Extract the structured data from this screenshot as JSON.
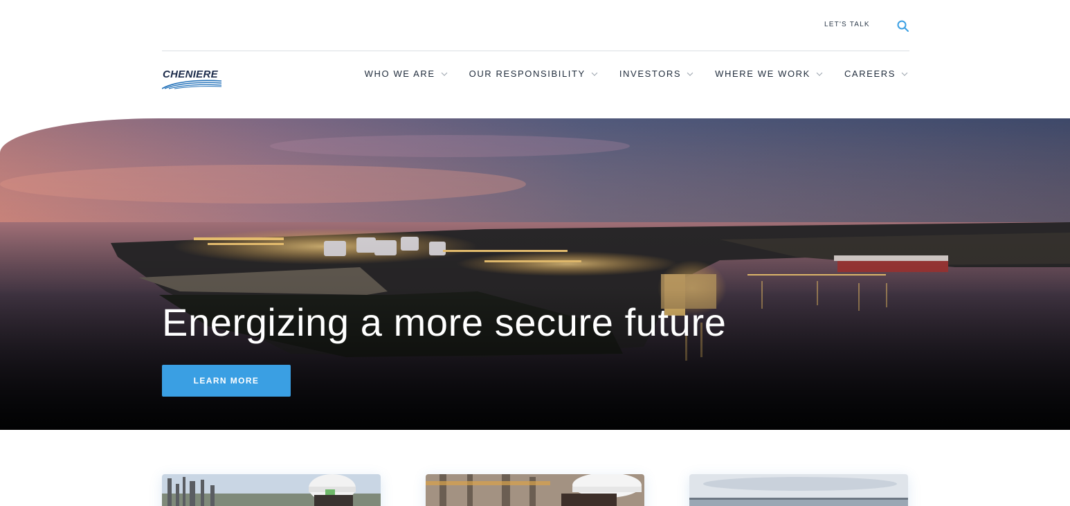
{
  "utility": {
    "lets_talk": "LET'S TALK",
    "search_icon": "search-icon"
  },
  "brand": {
    "logo_text": "CHENIERE",
    "color_primary": "#1c2b4a",
    "color_swoosh": "#1f6fb8"
  },
  "nav": {
    "items": [
      {
        "label": "WHO WE ARE"
      },
      {
        "label": "OUR RESPONSIBILITY"
      },
      {
        "label": "INVESTORS"
      },
      {
        "label": "WHERE WE WORK"
      },
      {
        "label": "CAREERS"
      }
    ]
  },
  "hero": {
    "title": "Energizing a more secure future",
    "cta_label": "LEARN MORE",
    "cta_color": "#3a9fe3"
  },
  "cards": [
    {
      "name": "card-refinery-worker"
    },
    {
      "name": "card-plant-worker"
    },
    {
      "name": "card-coastline"
    }
  ]
}
